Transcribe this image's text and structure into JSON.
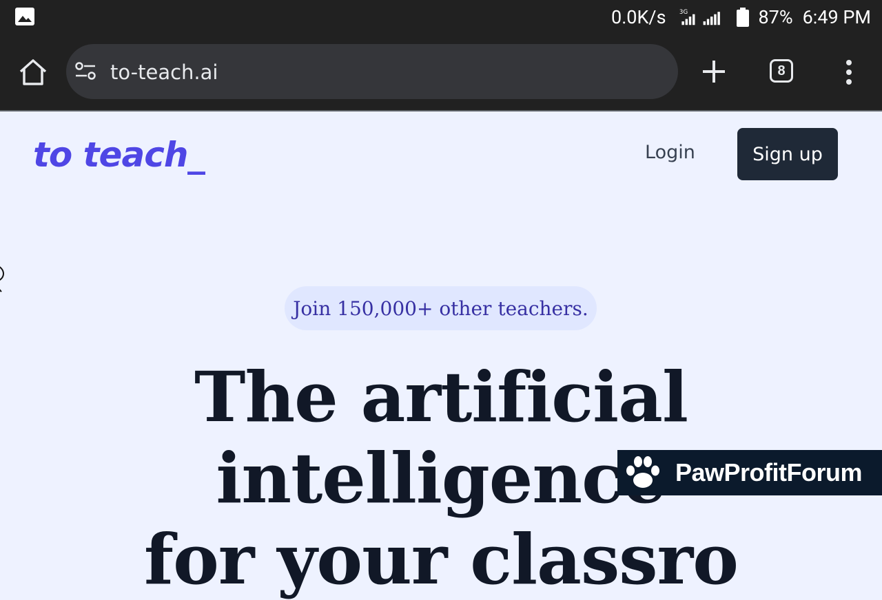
{
  "status_bar": {
    "speed": "0.0K/s",
    "network_type": "3G",
    "battery_percent": "87%",
    "time": "6:49 PM",
    "icons": [
      "image-icon",
      "signal-icon",
      "battery-icon"
    ]
  },
  "browser": {
    "url": "to-teach.ai",
    "tab_count": "8",
    "icons": [
      "home-icon",
      "site-settings-icon",
      "new-tab-icon",
      "more-menu-icon"
    ]
  },
  "nav": {
    "logo": "to teach_",
    "login_label": "Login",
    "signup_label": "Sign up"
  },
  "hero": {
    "badge": "Join 150,000+ other teachers.",
    "headline_line1": "The artificial intelligence",
    "headline_line2": "for your classro"
  },
  "watermark": {
    "text": "PawProfitForum"
  },
  "colors": {
    "brand": "#4f46e5",
    "page_bg": "#eef2ff",
    "badge_bg": "#e0e7ff",
    "badge_text": "#3730a3",
    "dark_button": "#1f2937",
    "browser_chrome": "#212121"
  }
}
